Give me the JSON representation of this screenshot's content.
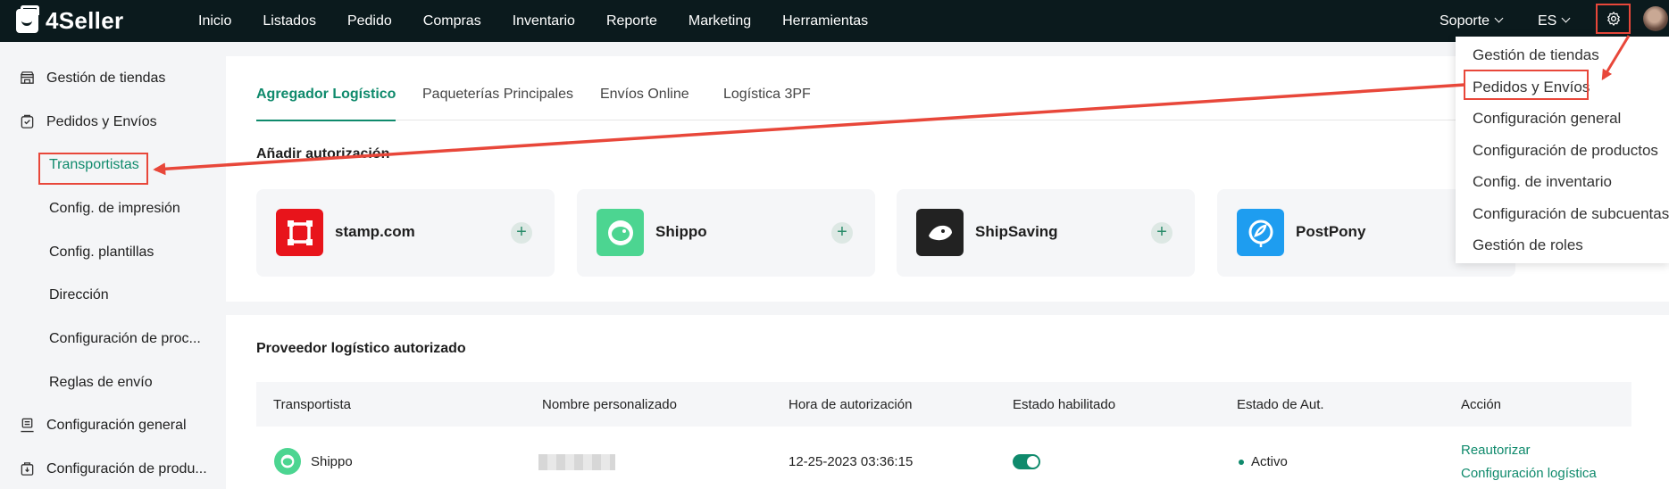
{
  "app": {
    "logo_text": "4Seller"
  },
  "topnav": {
    "items": [
      "Inicio",
      "Listados",
      "Pedido",
      "Compras",
      "Inventario",
      "Reporte",
      "Marketing",
      "Herramientas"
    ],
    "support_label": "Soporte",
    "language_label": "ES"
  },
  "sidebar": {
    "items": [
      {
        "label": "Gestión de tiendas",
        "level": "main",
        "icon": "store-icon"
      },
      {
        "label": "Pedidos y Envíos",
        "level": "main",
        "icon": "order-icon"
      },
      {
        "label": "Transportistas",
        "level": "sub",
        "active": true
      },
      {
        "label": "Config. de impresión",
        "level": "sub"
      },
      {
        "label": "Config. plantillas",
        "level": "sub"
      },
      {
        "label": "Dirección",
        "level": "sub"
      },
      {
        "label": "Configuración de proc...",
        "level": "sub"
      },
      {
        "label": "Reglas de envío",
        "level": "sub"
      },
      {
        "label": "Configuración general",
        "level": "main",
        "icon": "printer-icon"
      },
      {
        "label": "Configuración de produ...",
        "level": "main",
        "icon": "product-icon"
      }
    ]
  },
  "tabs": [
    {
      "label": "Agregador Logístico",
      "active": true
    },
    {
      "label": "Paqueterías Principales"
    },
    {
      "label": "Envíos Online"
    },
    {
      "label": "Logística 3PF"
    }
  ],
  "add_section": {
    "title": "Añadir autorización",
    "providers": [
      {
        "name": "stamp.com",
        "logo_color": "#e8141b"
      },
      {
        "name": "Shippo",
        "logo_color": "#4cd591"
      },
      {
        "name": "ShipSaving",
        "logo_color": "#222222"
      },
      {
        "name": "PostPony",
        "logo_color": "#1e9df0"
      }
    ]
  },
  "authorized": {
    "title": "Proveedor logístico autorizado",
    "headers": [
      "Transportista",
      "Nombre personalizado",
      "Hora de autorización",
      "Estado habilitado",
      "Estado de Aut.",
      "Acción"
    ],
    "rows": [
      {
        "carrier": "Shippo",
        "auth_time": "12-25-2023 03:36:15",
        "enabled": true,
        "auth_status": "Activo",
        "actions": [
          "Reautorizar",
          "Configuración logística"
        ]
      }
    ]
  },
  "settings_menu": {
    "items": [
      "Gestión de tiendas",
      "Pedidos y Envíos",
      "Configuración general",
      "Configuración de productos",
      "Config. de inventario",
      "Configuración de subcuentas",
      "Gestión de roles"
    ],
    "highlighted_index": 1
  },
  "colors": {
    "accent": "#0f8a6c",
    "annotation": "#e8473a",
    "topbar": "#0b1a1d"
  }
}
